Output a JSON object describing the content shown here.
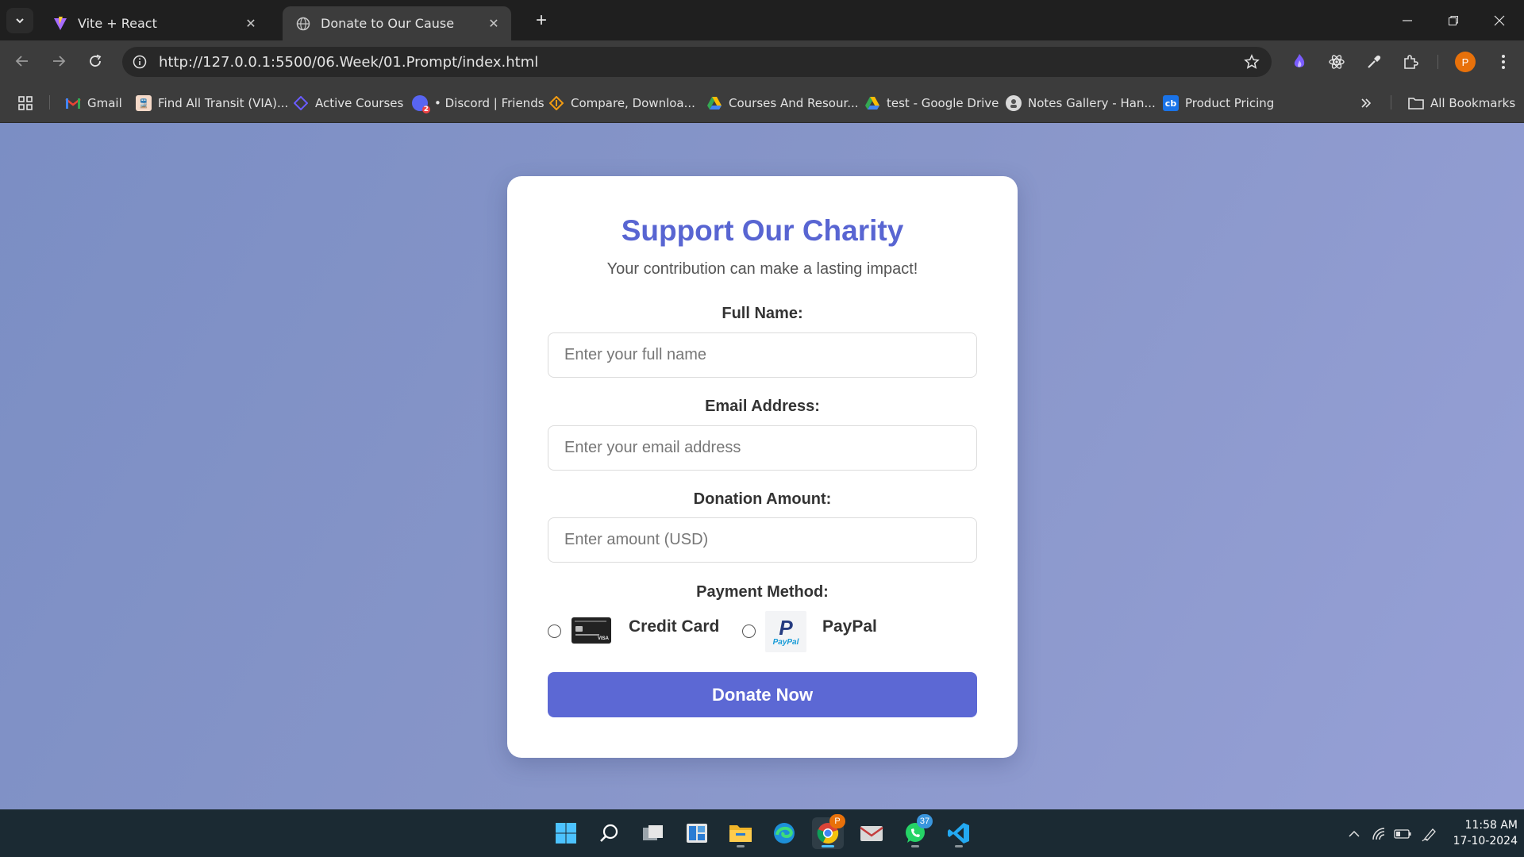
{
  "browser": {
    "tabs": [
      {
        "title": "Vite + React",
        "active": false
      },
      {
        "title": "Donate to Our Cause",
        "active": true
      }
    ],
    "url": "http://127.0.0.1:5500/06.Week/01.Prompt/index.html",
    "profile_initial": "P",
    "bookmarks": [
      {
        "label": "Gmail",
        "icon": "gmail-icon"
      },
      {
        "label": "Find All Transit (VIA)...",
        "icon": "train-icon"
      },
      {
        "label": "Active Courses",
        "icon": "courses-icon"
      },
      {
        "label": "• Discord | Friends",
        "icon": "discord-icon",
        "badge": "2"
      },
      {
        "label": "Compare, Downloa...",
        "icon": "compare-icon"
      },
      {
        "label": "Courses And Resour...",
        "icon": "google-drive-icon"
      },
      {
        "label": "test - Google Drive",
        "icon": "google-drive-icon"
      },
      {
        "label": "Notes Gallery - Han...",
        "icon": "notes-icon"
      },
      {
        "label": "Product Pricing",
        "icon": "cb-icon",
        "icon_text": "cb"
      }
    ],
    "all_bookmarks_label": "All Bookmarks"
  },
  "form": {
    "heading": "Support Our Charity",
    "subtitle": "Your contribution can make a lasting impact!",
    "full_name_label": "Full Name:",
    "full_name_placeholder": "Enter your full name",
    "email_label": "Email Address:",
    "email_placeholder": "Enter your email address",
    "amount_label": "Donation Amount:",
    "amount_placeholder": "Enter amount (USD)",
    "payment_label": "Payment Method:",
    "payment_options": [
      "Credit Card",
      "PayPal"
    ],
    "paypal_logo_text": "PayPal",
    "submit_label": "Donate Now"
  },
  "taskbar": {
    "whatsapp_badge": "37",
    "chrome_badge": "P",
    "time": "11:58 AM",
    "date": "17-10-2024"
  },
  "colors": {
    "accent": "#5865d2",
    "button": "#5c68d4",
    "page_bg_start": "#7b8ec4",
    "page_bg_end": "#96a0d6"
  }
}
